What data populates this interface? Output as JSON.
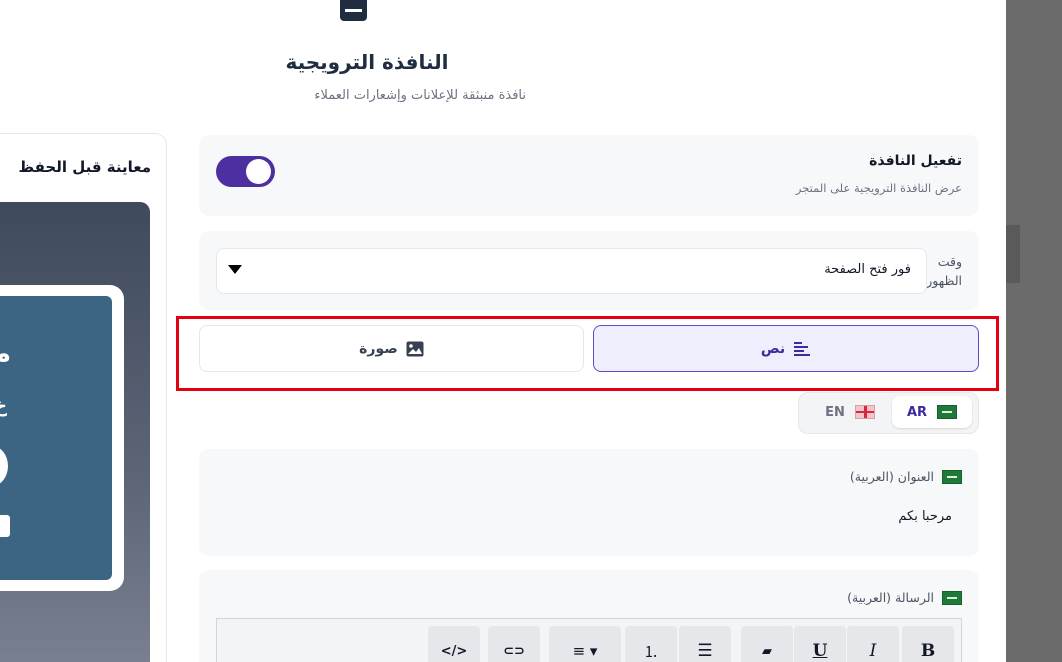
{
  "header": {
    "icon": "popup-window-icon",
    "title": "النافذة الترويجية",
    "subtitle": "نافذة منبثقة للإعلانات وإشعارات العملاء"
  },
  "preview": {
    "title": "معاينة قبل الحفظ",
    "popup_char_1": "م",
    "popup_char_2": "خ"
  },
  "activation": {
    "title": "تفعيل النافذة",
    "description": "عرض النافذة الترويجية على المتجر",
    "enabled": true,
    "accent_color": "#4c2fa0"
  },
  "timing": {
    "label": "وقت الظهور",
    "value": "فور فتح الصفحة"
  },
  "content_type_tabs": [
    {
      "label": "نص",
      "icon": "align-text-icon",
      "selected": true
    },
    {
      "label": "صورة",
      "icon": "image-icon",
      "selected": false
    }
  ],
  "highlight_color": "#e3000f",
  "languages": [
    {
      "code": "AR",
      "flag": "saudi-flag-icon",
      "selected": true
    },
    {
      "code": "EN",
      "flag": "uk-flag-icon",
      "selected": false
    }
  ],
  "title_field": {
    "label": "العنوان (العربية)",
    "value": "مرحبا بكم"
  },
  "message_field": {
    "label": "الرسالة (العربية)"
  },
  "toolbar": [
    {
      "icon": "bold-icon",
      "glyph": "B"
    },
    {
      "icon": "italic-icon",
      "glyph": "I"
    },
    {
      "icon": "underline-icon",
      "glyph": "U"
    },
    {
      "icon": "eraser-icon",
      "glyph": "▰"
    },
    {
      "icon": "bullet-list-icon",
      "glyph": "☰"
    },
    {
      "icon": "numbered-list-icon",
      "glyph": "⒈"
    },
    {
      "icon": "align-dropdown-icon",
      "glyph": "≡ ▾"
    },
    {
      "icon": "link-icon",
      "glyph": "⊂⊃"
    },
    {
      "icon": "code-icon",
      "glyph": "</>"
    }
  ]
}
